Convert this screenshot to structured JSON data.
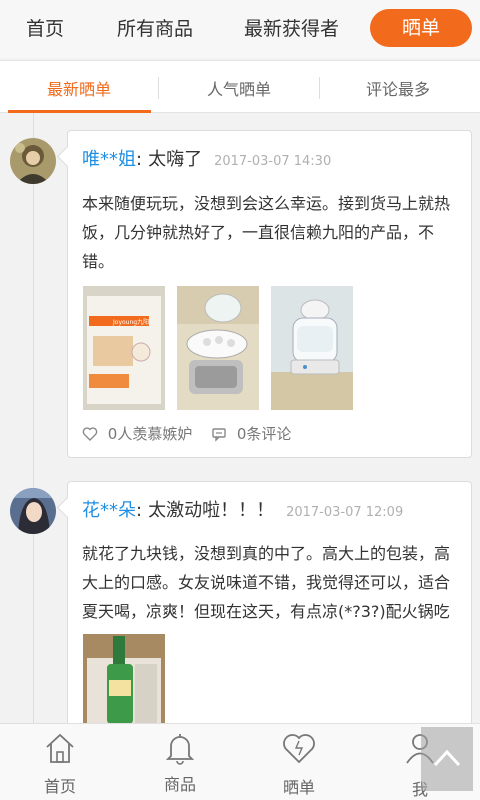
{
  "topnav": {
    "items": [
      "首页",
      "所有商品",
      "最新获得者"
    ],
    "active": "晒单"
  },
  "subtabs": {
    "tabs": [
      "最新晒单",
      "人气晒单",
      "评论最多"
    ]
  },
  "posts": [
    {
      "user": "唯**姐",
      "colon": ":",
      "title": "太嗨了",
      "time": "2017-03-07 14:30",
      "text": "本来随便玩玩，没想到会这么幸运。接到货马上就热饭，几分钟就热好了，一直很信赖九阳的产品，不错。",
      "likes": "0人羡慕嫉妒",
      "comments": "0条评论"
    },
    {
      "user": "花**朵",
      "colon": ":",
      "title": "太激动啦！！！",
      "time": "2017-03-07 12:09",
      "text": "就花了九块钱，没想到真的中了。高大上的包装，高大上的口感。女友说味道不错，我觉得还可以，适合夏天喝，凉爽！但现在这天，有点凉(*?3?)配火锅吃"
    }
  ],
  "photo_labels": {
    "brand": "Joyoung九阳"
  },
  "bottombar": {
    "items": [
      "首页",
      "商品",
      "晒单",
      "我"
    ]
  },
  "colors": {
    "accent": "#f26a1b",
    "username": "#1f8fe5"
  }
}
